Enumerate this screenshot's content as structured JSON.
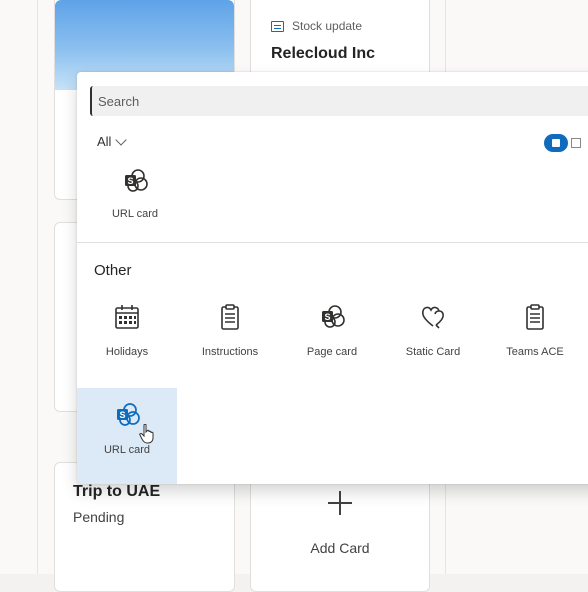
{
  "dashboard": {
    "stock_card": {
      "label": "Stock update",
      "company": "Relecloud Inc"
    },
    "trip_card": {
      "title": "Trip to UAE",
      "status": "Pending"
    },
    "add_card": {
      "label": "Add Card"
    }
  },
  "picker": {
    "search": {
      "placeholder": "Search",
      "value": ""
    },
    "filter": {
      "selected": "All"
    },
    "view_toggle": {
      "grid_selected": true
    },
    "top_items": [
      {
        "label": "URL card",
        "icon": "sharepoint-card-icon"
      }
    ],
    "section_title": "Other",
    "other_items": [
      {
        "label": "Holidays",
        "icon": "calendar-icon"
      },
      {
        "label": "Instructions",
        "icon": "clipboard-icon"
      },
      {
        "label": "Page card",
        "icon": "sharepoint-page-icon"
      },
      {
        "label": "Static Card",
        "icon": "heart-chat-icon"
      },
      {
        "label": "Teams ACE",
        "icon": "clipboard-icon"
      },
      {
        "label": "URL card",
        "icon": "sharepoint-card-icon",
        "selected": true
      }
    ]
  },
  "colors": {
    "accent": "#0f6cbd",
    "selected_tile": "#dce9f7",
    "panel": "#ffffff"
  }
}
